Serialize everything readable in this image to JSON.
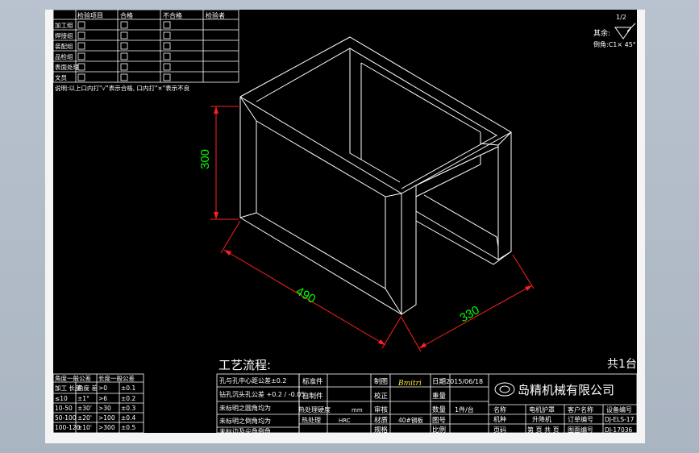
{
  "inspection_table": {
    "header": [
      "检验项目",
      "合格",
      "不合格",
      "检验者",
      "日期"
    ],
    "rows": [
      "加工组",
      "焊接组",
      "装配组",
      "品检组",
      "表面处理",
      "文员"
    ],
    "note": "说明:以上口内打\"√\"表示合格, 口内打\"×\"表示不良"
  },
  "top_right": {
    "sheet": "1/2",
    "rough_label": "其余:",
    "chamfer": "倒角:C1× 45°"
  },
  "dimensions": {
    "height": "300",
    "width": "490",
    "depth": "330"
  },
  "process_title": "工艺流程:",
  "total": "共1台",
  "tolerance_table": {
    "headers": [
      "角度一般公差",
      "长度一般公差"
    ],
    "rows": [
      [
        "加工 长度",
        "角度 差",
        ">0",
        "±0.1"
      ],
      [
        "≤10",
        "±1°",
        ">6",
        "±0.2"
      ],
      [
        "10-50",
        "±30'",
        ">30",
        "±0.3"
      ],
      [
        "50-100",
        "±20'",
        ">100",
        "±0.4"
      ],
      [
        "100-120",
        "±10'",
        ">300",
        "±0.5"
      ],
      [
        "",
        "",
        ">1000",
        "±0.6"
      ]
    ]
  },
  "notes": [
    "孔与孔中心距公差±0.2",
    "钻孔沉头孔公差 +0.2 / -0.05",
    "未标明之圆角均为",
    "未标明之倒角均为",
    "未标边及尖角倒角"
  ],
  "title_block": {
    "labels": [
      "标准件",
      "自制件",
      "热处理",
      "热处理硬度",
      "制图",
      "校正",
      "审核",
      "材质",
      "规格",
      "日期",
      "重量",
      "数量",
      "图号",
      "比例"
    ],
    "heat": "HRC",
    "unit_mm": "mm",
    "date": "2015/06/18",
    "quantity": "1件/台",
    "material": "40#钢板",
    "signature": "Bmitri",
    "company": "岛精机械有限公司",
    "cols": [
      "名称",
      "电机护罩",
      "客户名称",
      "设备编号"
    ],
    "col_values": [
      "机种",
      "升降机",
      "订单编号",
      "DJ-ELS-17"
    ],
    "col_values2": [
      "页码",
      "第 页 共 页",
      "图面编号",
      "DJ-17036"
    ]
  }
}
